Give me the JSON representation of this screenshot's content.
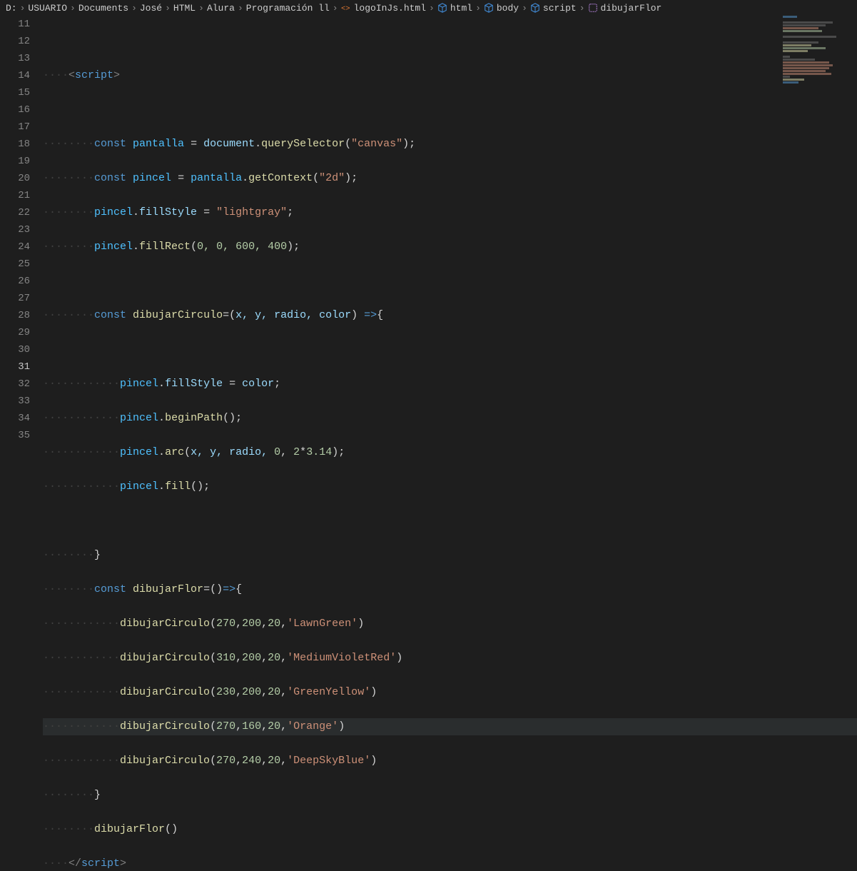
{
  "breadcrumb": {
    "items": [
      {
        "label": "D:",
        "icon": ""
      },
      {
        "label": "USUARIO",
        "icon": ""
      },
      {
        "label": "Documents",
        "icon": ""
      },
      {
        "label": "José",
        "icon": ""
      },
      {
        "label": "HTML",
        "icon": ""
      },
      {
        "label": "Alura",
        "icon": ""
      },
      {
        "label": "Programación ll",
        "icon": ""
      },
      {
        "label": "logoInJs.html",
        "icon": "file"
      },
      {
        "label": "html",
        "icon": "cube"
      },
      {
        "label": "body",
        "icon": "cube"
      },
      {
        "label": "script",
        "icon": "cube"
      },
      {
        "label": "dibujarFlor",
        "icon": "func"
      }
    ],
    "sep": "›"
  },
  "gutter": {
    "start": 11,
    "end": 35,
    "active": 31
  },
  "code": {
    "l12_tag_open": "<",
    "l12_tag_name": "script",
    "l12_tag_close": ">",
    "l14_const": "const",
    "l14_var": "pantalla",
    "l14_eq": " = ",
    "l14_doc": "document",
    "l14_dot": ".",
    "l14_qs": "querySelector",
    "l14_p1": "(",
    "l14_str": "\"canvas\"",
    "l14_p2": ");",
    "l15_const": "const",
    "l15_var": "pincel",
    "l15_eq": " = ",
    "l15_pant": "pantalla",
    "l15_gc": "getContext",
    "l15_str": "\"2d\"",
    "l16_p": "pincel",
    "l16_fs": "fillStyle",
    "l16_eq": " = ",
    "l16_str": "\"lightgray\"",
    "l16_semi": ";",
    "l17_fr": "fillRect",
    "l17_args": "0, 0, 600, 400",
    "l19_const": "const",
    "l19_var": "dibujarCirculo",
    "l19_params": "x, y, radio, color",
    "l19_arrow": " =>",
    "l21_fs": "fillStyle",
    "l21_eq": " = ",
    "l21_col": "color",
    "l22_bp": "beginPath",
    "l23_arc": "arc",
    "l23_args_a": "x, y, radio, ",
    "l23_n0": "0",
    "l23_c": ", ",
    "l23_n2": "2",
    "l23_star": "*",
    "l23_pi": "3.14",
    "l24_fill": "fill",
    "l27_var": "dibujarFlor",
    "l27_paren": "()",
    "l28_fn": "dibujarCirculo",
    "l28_a": "270",
    "l28_b": "200",
    "l28_c": "20",
    "l28_s": "'LawnGreen'",
    "l29_a": "310",
    "l29_b": "200",
    "l29_c": "20",
    "l29_s": "'MediumVioletRed'",
    "l30_a": "230",
    "l30_b": "200",
    "l30_c": "20",
    "l30_s": "'GreenYellow'",
    "l31_a": "270",
    "l31_b": "160",
    "l31_c": "20",
    "l31_s": "'Orange'",
    "l32_a": "270",
    "l32_b": "240",
    "l32_c": "20",
    "l32_s": "'DeepSkyBlue'",
    "l34_call": "dibujarFlor",
    "l35_tag_open": "</",
    "l35_tag_name": "script",
    "l35_tag_close": ">",
    "dot": ".",
    "comma": ",",
    "po": "(",
    "pc": ")",
    "bo": "{",
    "bc": "}",
    "semi": ";",
    "eq": "=",
    "ws4": "····",
    "ws8": "········",
    "ws12": "············"
  }
}
